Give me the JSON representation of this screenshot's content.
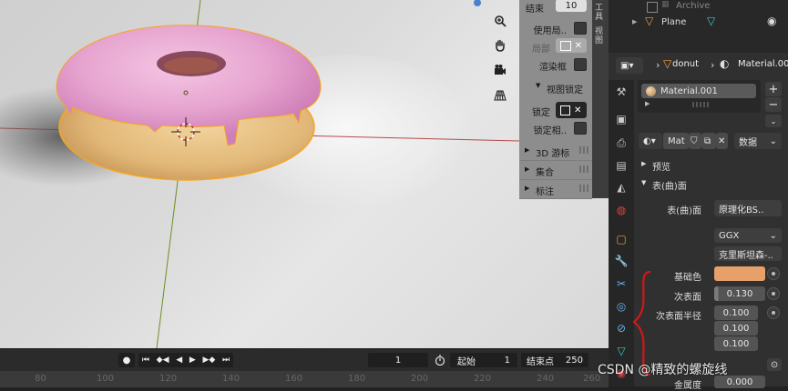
{
  "npanel": {
    "end_label": "结束",
    "end_value": "10",
    "use_local_label": "使用局..",
    "local_label": "局部",
    "render_border_label": "渲染框",
    "view_lock_label": "视图锁定",
    "lock_label": "锁定",
    "lock_camera_label": "锁定相..",
    "cursor_section": "3D 游标",
    "collection_section": "集合",
    "annotation_section": "标注",
    "tabs": [
      "工具",
      "视图"
    ]
  },
  "timeline": {
    "current_frame": "1",
    "start_label": "起始",
    "start_value": "1",
    "end_label": "结束点",
    "end_value": "250",
    "ruler_ticks": [
      "80",
      "100",
      "120",
      "140",
      "160",
      "180",
      "200",
      "220",
      "240",
      "260",
      "280"
    ]
  },
  "outliner": {
    "archive_label": "Archive",
    "plane_label": "Plane"
  },
  "properties": {
    "object_name": "donut",
    "material_header": "Material.00",
    "slot_name": "Material.001",
    "mat_datablock": "Mat",
    "data_dropdown": "数据",
    "preview_section": "预览",
    "surface_section": "表(曲)面",
    "surface_label": "表(曲)面",
    "surface_value": "原理化BS..",
    "distribution_value": "GGX",
    "subsurface_method_value": "克里斯坦森-..",
    "base_color_label": "基础色",
    "base_color": "#e8a06a",
    "subsurface_label": "次表面",
    "subsurface_value": "0.130",
    "subsurface_radius_label": "次表面半径",
    "radius_values": [
      "0.100",
      "0.100",
      "0.100"
    ],
    "metallic_label": "金属度",
    "metallic_value": "0.000"
  },
  "watermark": "CSDN @精致的螺旋线",
  "colors": {
    "icing": "#e6a3cf",
    "dough": "#e8c389",
    "selection": "#f5a623",
    "annotation": "#d01818"
  }
}
